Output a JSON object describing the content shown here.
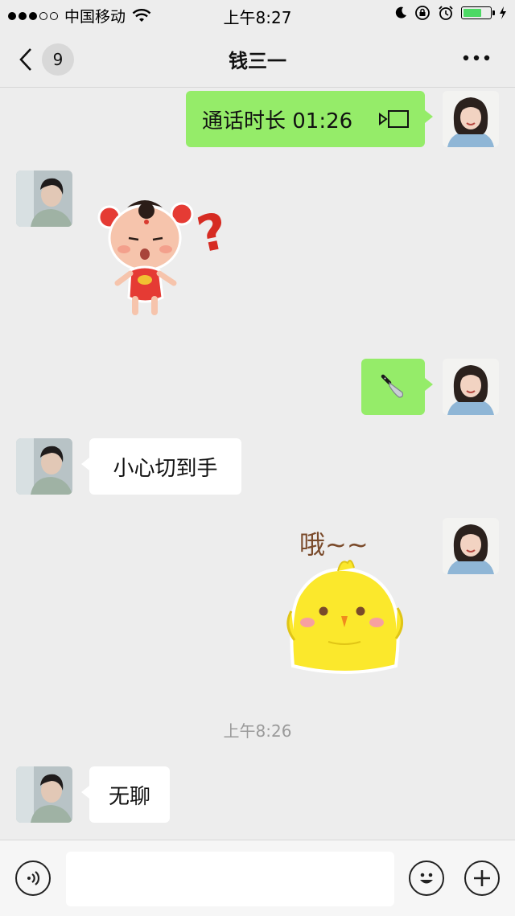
{
  "status_bar": {
    "carrier": "中国移动",
    "time": "上午8:27"
  },
  "nav": {
    "unread_count": "9",
    "title": "钱三一",
    "more": "•••"
  },
  "messages": {
    "call": {
      "text": "通话时长 01:26"
    },
    "sticker_doll": {
      "text": "?"
    },
    "reply1": {
      "text": "小心切到手"
    },
    "sticker_chick": {
      "text": "哦~~"
    },
    "timestamp": "上午8:26",
    "reply2": {
      "text": "无聊"
    }
  },
  "input": {
    "placeholder": ""
  },
  "colors": {
    "my_bubble": "#95ec69",
    "their_bubble": "#ffffff",
    "background": "#ededed"
  },
  "icons": [
    "signal-dots",
    "wifi-icon",
    "moon-icon",
    "rotation-lock-icon",
    "alarm-icon",
    "battery-icon",
    "back-chevron-icon",
    "more-icon",
    "video-call-icon",
    "knife-icon",
    "voice-icon",
    "emoji-icon",
    "plus-icon"
  ]
}
